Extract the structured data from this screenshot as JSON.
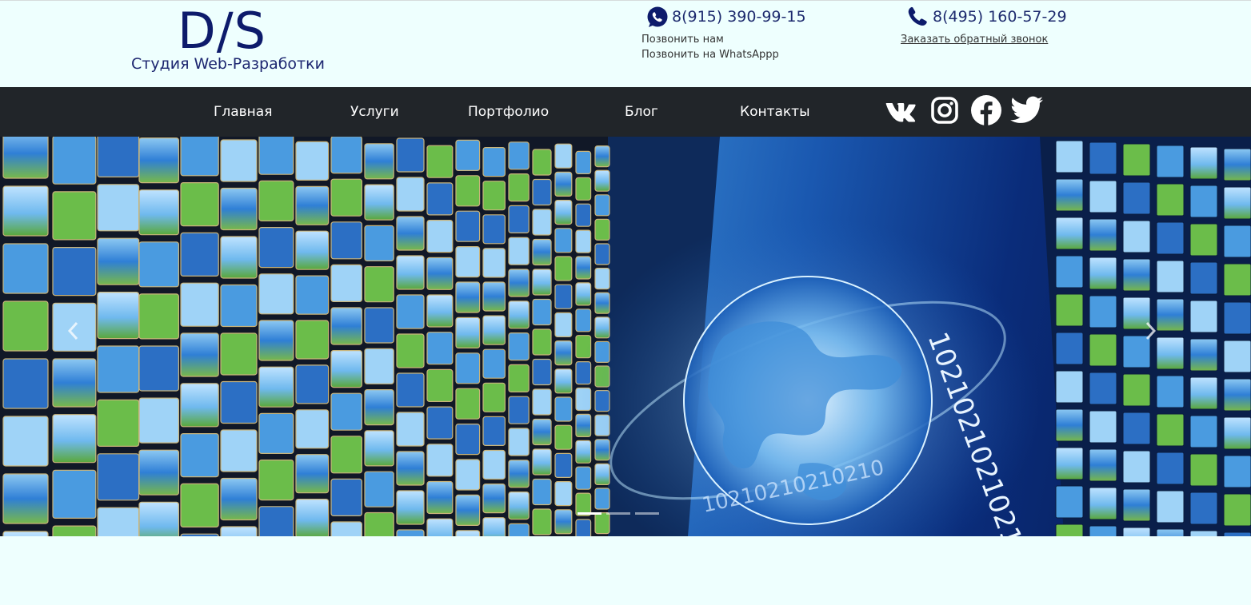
{
  "logo": {
    "mark": "D/S",
    "subtitle": "Студия Web-Разработки"
  },
  "contacts": {
    "whatsapp": {
      "icon": "whatsapp-icon",
      "phone": "8(915) 390-99-15",
      "line1": "Позвонить нам",
      "line2": "Позвонить на WhatsAppp"
    },
    "office": {
      "icon": "phone-icon",
      "phone": "8(495) 160-57-29",
      "callback_link": "Заказать обратный звонок"
    }
  },
  "nav": {
    "items": [
      {
        "label": "Главная"
      },
      {
        "label": "Услуги"
      },
      {
        "label": "Портфолио"
      },
      {
        "label": "Блог"
      },
      {
        "label": "Контакты"
      }
    ],
    "social": [
      "vk-icon",
      "instagram-icon",
      "facebook-icon",
      "twitter-icon"
    ]
  },
  "carousel": {
    "prev_icon": "chevron-left-icon",
    "next_icon": "chevron-right-icon",
    "slides": 3,
    "active_slide": 1,
    "image_text": "10210210210210"
  },
  "colors": {
    "page_bg": "#eefffe",
    "navbar_bg": "#212529",
    "brand_blue": "#0d1b6b"
  }
}
